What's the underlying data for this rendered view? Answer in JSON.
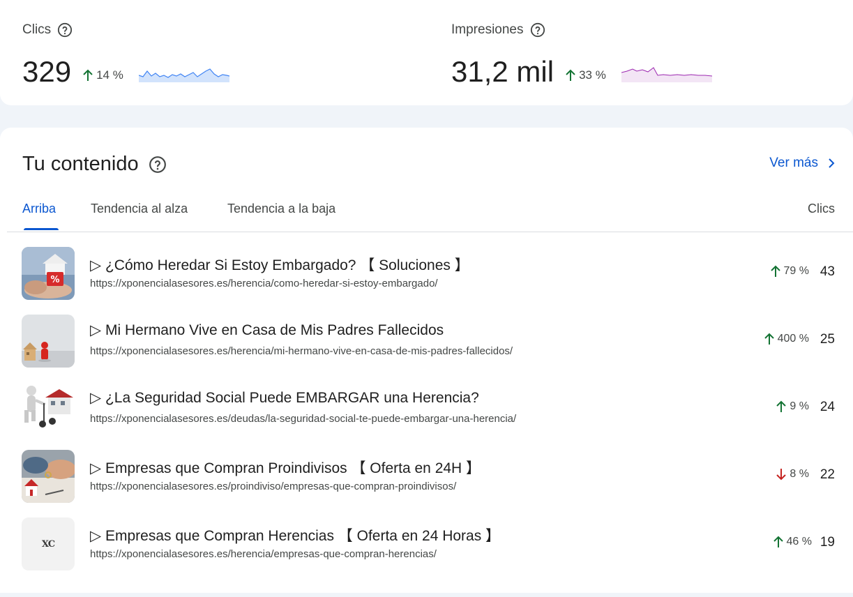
{
  "metrics": {
    "clicks": {
      "label": "Clics",
      "value": "329",
      "delta": "14 %",
      "direction": "up",
      "spark_color": "#4285f4"
    },
    "impressions": {
      "label": "Impresiones",
      "value": "31,2 mil",
      "delta": "33 %",
      "direction": "up",
      "spark_color": "#9c27b0"
    }
  },
  "content": {
    "title": "Tu contenido",
    "see_more": "Ver más",
    "tabs": [
      "Arriba",
      "Tendencia al alza",
      "Tendencia a la baja"
    ],
    "active_tab": "Arriba",
    "column_header": "Clics",
    "rows": [
      {
        "title": "▷ ¿Cómo Heredar Si Estoy Embargado? 【 Soluciones 】",
        "url": "https://xponencialasesores.es/herencia/como-heredar-si-estoy-embargado/",
        "delta": "79 %",
        "direction": "up",
        "clicks": "43",
        "thumb": "house-percent-thumbnail"
      },
      {
        "title": "▷ Mi Hermano Vive en Casa de Mis Padres Fallecidos",
        "url": "https://xponencialasesores.es/herencia/mi-hermano-vive-en-casa-de-mis-padres-fallecidos/",
        "delta": "400 %",
        "direction": "up",
        "clicks": "25",
        "thumb": "house-figure-thumbnail"
      },
      {
        "title": "▷ ¿La Seguridad Social Puede EMBARGAR una Herencia?",
        "url": "https://xponencialasesores.es/deudas/la-seguridad-social-te-puede-embargar-una-herencia/",
        "delta": "9 %",
        "direction": "up",
        "clicks": "24",
        "thumb": "hand-truck-house-thumbnail"
      },
      {
        "title": "▷ Empresas que Compran Proindivisos 【 Oferta en 24H 】",
        "url": "https://xponencialasesores.es/proindiviso/empresas-que-compran-proindivisos/",
        "delta": "8 %",
        "direction": "down",
        "clicks": "22",
        "thumb": "key-handover-thumbnail"
      },
      {
        "title": "▷ Empresas que Compran Herencias 【 Oferta en 24 Horas 】",
        "url": "https://xponencialasesores.es/herencia/empresas-que-compran-herencias/",
        "delta": "46 %",
        "direction": "up",
        "clicks": "19",
        "thumb": "xc-logo-thumbnail",
        "thumb_text": "XC"
      }
    ]
  },
  "colors": {
    "up": "#137333",
    "down": "#c5221f",
    "accent": "#0b57d0"
  }
}
